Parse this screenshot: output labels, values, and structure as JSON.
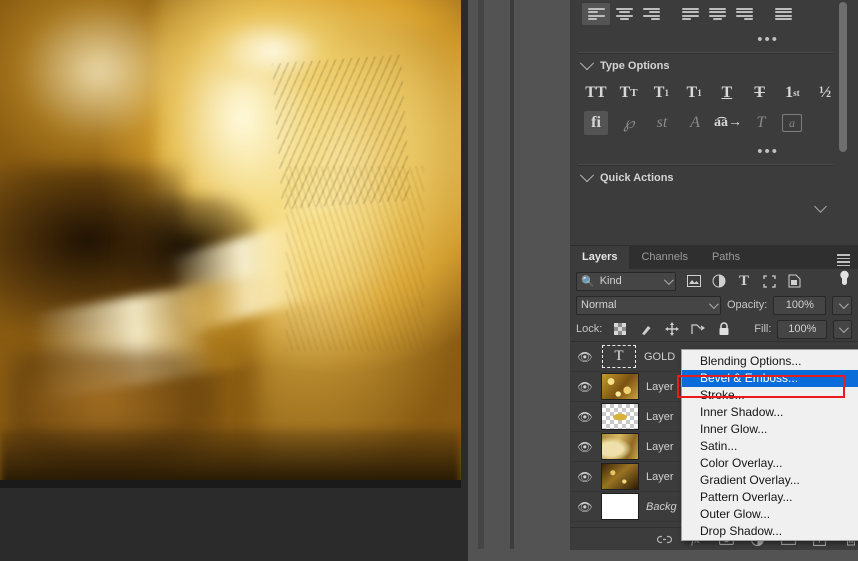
{
  "app": {
    "name": "Adobe Photoshop",
    "workspace_bg": "#2b2b2b",
    "panel_bg": "#3c3c3c",
    "accent_highlight": "#0a6cd8",
    "annotation_color": "#e81c1c"
  },
  "document": {
    "image_description": "Close-up of a golden metallic face with glossy highlights"
  },
  "properties_panel": {
    "alignment": {
      "name": "paragraph-alignment",
      "buttons": [
        {
          "icon": "align-left-icon",
          "selected": true
        },
        {
          "icon": "align-center-icon",
          "selected": false
        },
        {
          "icon": "align-right-icon",
          "selected": false
        },
        {
          "icon": "justify-last-left-icon",
          "selected": false
        },
        {
          "icon": "justify-last-center-icon",
          "selected": false
        },
        {
          "icon": "justify-last-right-icon",
          "selected": false
        },
        {
          "icon": "justify-all-icon",
          "selected": false
        }
      ],
      "more_label": "•••"
    },
    "type_options": {
      "title": "Type Options",
      "row1": [
        {
          "icon": "all-caps-icon",
          "glyph": "TT",
          "selected": false,
          "dim": false
        },
        {
          "icon": "small-caps-icon",
          "glyph": "Tᴛ",
          "selected": false,
          "dim": false
        },
        {
          "icon": "superscript-icon",
          "glyph": "T¹",
          "selected": false,
          "dim": false
        },
        {
          "icon": "subscript-icon",
          "glyph": "T₁",
          "selected": false,
          "dim": false
        },
        {
          "icon": "underline-icon",
          "glyph": "T",
          "selected": false,
          "dim": false
        },
        {
          "icon": "strikethrough-icon",
          "glyph": "T",
          "selected": false,
          "dim": false
        },
        {
          "icon": "ordinals-icon",
          "glyph": "1st",
          "selected": false,
          "dim": false
        },
        {
          "icon": "fractions-icon",
          "glyph": "½",
          "selected": false,
          "dim": false
        }
      ],
      "row2": [
        {
          "icon": "ligatures-icon",
          "glyph": "fi",
          "selected": true,
          "dim": false
        },
        {
          "icon": "swash-icon",
          "glyph": "℘",
          "selected": false,
          "dim": true
        },
        {
          "icon": "stylistic-alternates-icon",
          "glyph": "st",
          "selected": false,
          "dim": true
        },
        {
          "icon": "titling-alternates-icon",
          "glyph": "A",
          "selected": false,
          "dim": true
        },
        {
          "icon": "contextual-alternates-icon",
          "glyph": "aa",
          "selected": false,
          "dim": false
        },
        {
          "icon": "stylistic-sets-icon",
          "glyph": "T",
          "selected": false,
          "dim": true
        },
        {
          "icon": "standard-vertical-roman-icon",
          "glyph": "a",
          "selected": false,
          "dim": true
        }
      ],
      "more_label": "•••"
    },
    "quick_actions": {
      "title": "Quick Actions"
    }
  },
  "layers_panel": {
    "tabs": [
      {
        "label": "Layers",
        "active": true
      },
      {
        "label": "Channels",
        "active": false
      },
      {
        "label": "Paths",
        "active": false
      }
    ],
    "menu_icon": "panel-menu-icon",
    "filter": {
      "search_icon": "search-icon",
      "kind_label": "Kind",
      "icons": [
        "filter-pixel-icon",
        "filter-adjustment-icon",
        "filter-type-icon",
        "filter-shape-icon",
        "filter-smart-object-icon"
      ],
      "toggle_icon": "filter-toggle-icon"
    },
    "blend": {
      "mode": "Normal",
      "opacity_label": "Opacity:",
      "opacity_value": "100%"
    },
    "lock": {
      "label": "Lock:",
      "icons": [
        "lock-transparent-pixels-icon",
        "lock-image-pixels-icon",
        "lock-position-icon",
        "lock-artboard-nesting-icon",
        "lock-all-icon"
      ],
      "fill_label": "Fill:",
      "fill_value": "100%"
    },
    "layers": [
      {
        "name": "GOLD",
        "thumb": "text",
        "visible": true,
        "italic": false
      },
      {
        "name": "Layer",
        "thumb": "gold-bright",
        "visible": true,
        "italic": false
      },
      {
        "name": "Layer",
        "thumb": "transparent",
        "visible": true,
        "italic": false
      },
      {
        "name": "Layer",
        "thumb": "gold-pale",
        "visible": true,
        "italic": false
      },
      {
        "name": "Layer",
        "thumb": "gold-dark",
        "visible": true,
        "italic": false
      },
      {
        "name": "Backg",
        "thumb": "white",
        "visible": true,
        "italic": true
      }
    ],
    "footer_icons": [
      "link-layers-icon",
      "add-layer-style-icon",
      "add-layer-mask-icon",
      "new-fill-adjustment-icon",
      "new-group-icon",
      "new-layer-icon",
      "delete-layer-icon"
    ]
  },
  "context_menu": {
    "name": "layer-style-menu",
    "items": [
      {
        "label": "Blending Options...",
        "selected": false
      },
      {
        "label": "Bevel & Emboss...",
        "selected": true
      },
      {
        "label": "Stroke...",
        "selected": false
      },
      {
        "label": "Inner Shadow...",
        "selected": false
      },
      {
        "label": "Inner Glow...",
        "selected": false
      },
      {
        "label": "Satin...",
        "selected": false
      },
      {
        "label": "Color Overlay...",
        "selected": false
      },
      {
        "label": "Gradient Overlay...",
        "selected": false
      },
      {
        "label": "Pattern Overlay...",
        "selected": false
      },
      {
        "label": "Outer Glow...",
        "selected": false
      },
      {
        "label": "Drop Shadow...",
        "selected": false
      }
    ]
  }
}
